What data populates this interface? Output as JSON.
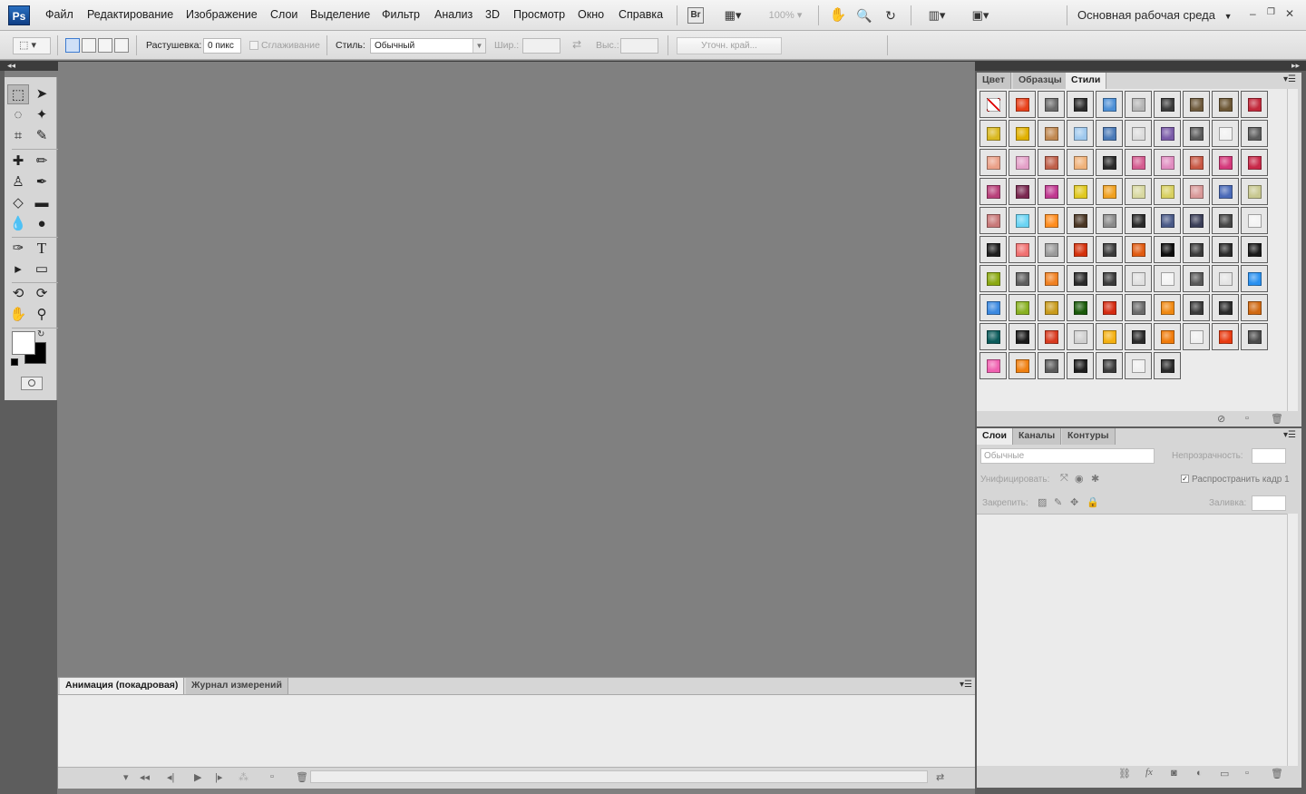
{
  "menubar": {
    "logo": "Ps",
    "items": [
      "Файл",
      "Редактирование",
      "Изображение",
      "Слои",
      "Выделение",
      "Фильтр",
      "Анализ",
      "3D",
      "Просмотр",
      "Окно",
      "Справка"
    ],
    "bridge": "Br",
    "zoom": "100%",
    "workspace": "Основная рабочая среда",
    "window_buttons": [
      "–",
      "❐",
      "✕"
    ]
  },
  "options": {
    "feather_label": "Растушевка:",
    "feather_value": "0 пикс",
    "antialias_label": "Сглаживание",
    "style_label": "Стиль:",
    "style_value": "Обычный",
    "width_label": "Шир.:",
    "height_label": "Выс.:",
    "refine_label": "Уточн. край..."
  },
  "bottom_panel": {
    "tabs": [
      "Анимация (покадровая)",
      "Журнал измерений"
    ]
  },
  "styles_panel": {
    "tabs": [
      "Цвет",
      "Образцы",
      "Стили"
    ],
    "swatches": [
      [
        "none",
        "#e8401a",
        "#6a6a6a",
        "#2b2b2b",
        "#4c8fd6",
        "#b4b4b4",
        "#3a3a3a",
        "#6e5a3c",
        "#6c5634",
        "#c2283a"
      ],
      [
        "#d9b820",
        "#e0b000",
        "#c08850",
        "#9ec8ee",
        "#4a7ab8",
        "#dcdcdc",
        "#7a5aa8",
        "#5a5a5a",
        "#f2f2f2",
        "#5c5c5c"
      ],
      [
        "#eaa088",
        "#e4a0c8",
        "#c0604a",
        "#f0b27a",
        "#2a2a2a",
        "#d45c90",
        "#e08cc0",
        "#c85844",
        "#d4387a",
        "#c82848"
      ],
      [
        "#b8407a",
        "#7a2850",
        "#c03890",
        "#e0c820",
        "#f0a020",
        "#d8d8a0",
        "#d8d060",
        "#d89898",
        "#4a6ab8",
        "#c8c890"
      ],
      [
        "#c87878",
        "#6ad4f4",
        "#ff8c1e",
        "#4a3624",
        "#8a8a8a",
        "#2a2a2a",
        "#4a5a88",
        "#3a3e58",
        "#464646",
        "#f4f4f4"
      ],
      [
        "#1e1e1e",
        "#f07070",
        "#9a9a9a",
        "#d4300a",
        "#3a3a3a",
        "#e05a10",
        "#0e0e0e",
        "#3a3a3a",
        "#2a2a2a",
        "#1a1a1a"
      ],
      [
        "#8aa810",
        "#5e5e5e",
        "#f08020",
        "#2a2a2a",
        "#3a3a3a",
        "#e0e0e0",
        "#f4f4f4",
        "#585858",
        "#e4e4e4",
        "#2890f0"
      ],
      [
        "#3a88e0",
        "#88b020",
        "#c89a1a",
        "#1a5a0a",
        "#d42a10",
        "#6a6a6a",
        "#f08810",
        "#3a3a3a",
        "#2a2a2a",
        "#d06810"
      ],
      [
        "#0a5a5a",
        "#1a1a1a",
        "#d83a1e",
        "#d0d0d0",
        "#f4b010",
        "#2a2a2a",
        "#f07a08",
        "#f0f0f0",
        "#e83a10",
        "#4a4a4a"
      ],
      [
        "#f060b0",
        "#f08010",
        "#5a5a5a",
        "#1e1e1e",
        "#3a3a3a",
        "#f0f0f0",
        "#2a2a2a"
      ]
    ]
  },
  "layers_panel": {
    "tabs": [
      "Слои",
      "Каналы",
      "Контуры"
    ],
    "blend_mode": "Обычные",
    "opacity_label": "Непрозрачность:",
    "unify_label": "Унифицировать:",
    "propagate_label": "Распространить кадр 1",
    "lock_label": "Закрепить:",
    "fill_label": "Заливка:"
  }
}
